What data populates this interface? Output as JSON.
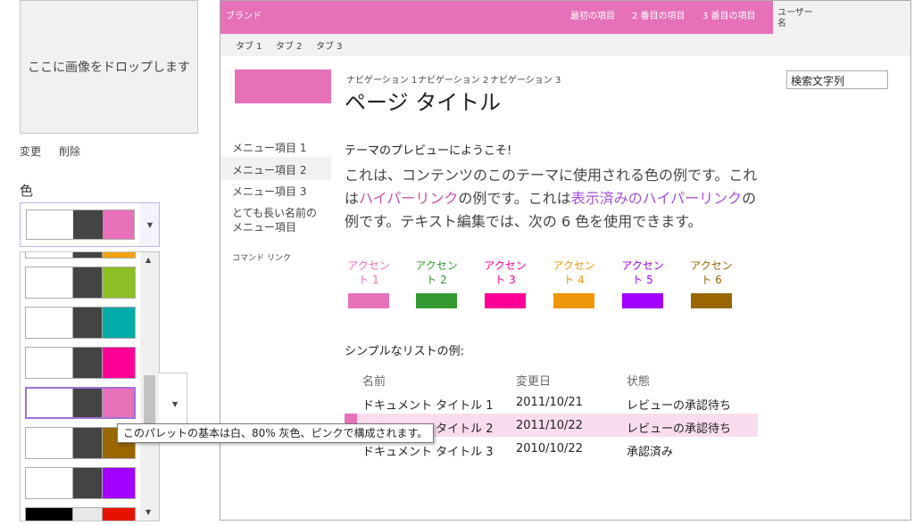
{
  "left_panel": {
    "dropzone_text": "ここに画像をドロップします",
    "change_label": "変更",
    "delete_label": "削除",
    "color_heading": "色",
    "tooltip": "このパレットの基本は白、80% 灰色、ピンクで構成されます。",
    "selected_palette": [
      "#ffffff",
      "#444444",
      "#e671b8"
    ],
    "palettes": [
      [
        "#ffffff",
        "#444444",
        "#f3a20e"
      ],
      [
        "#ffffff",
        "#444444",
        "#8cbf26"
      ],
      [
        "#ffffff",
        "#444444",
        "#00aba9"
      ],
      [
        "#ffffff",
        "#444444",
        "#ff0097"
      ],
      [
        "#ffffff",
        "#444444",
        "#e671b8"
      ],
      [
        "#ffffff",
        "#444444",
        "#996600"
      ],
      [
        "#ffffff",
        "#444444",
        "#a200ff"
      ],
      [
        "#000000",
        "#e8e8e8",
        "#e51400"
      ]
    ],
    "highlighted_palette_index": 4
  },
  "preview": {
    "brand": "ブランド",
    "top_nav": [
      "最初の項目",
      "2 番目の項目",
      "3 番目の項目"
    ],
    "user_name": "ユーザー\n名",
    "tabs": [
      "タブ 1",
      "タブ 2",
      "タブ 3"
    ],
    "breadcrumb": [
      "ナビゲーション 1",
      "ナビゲーション 2",
      "ナビゲーション 3"
    ],
    "page_title": "ページ タイトル",
    "search_value": "検索文字列",
    "menu": [
      "メニュー項目 1",
      "メニュー項目 2",
      "メニュー項目 3",
      "とても長い名前の\nメニュー項目"
    ],
    "command_link": "コマンド リンク",
    "welcome": "テーマのプレビューにようこそ!",
    "body": {
      "part1": "これは、コンテンツのこのテーマに使用される色の例です。これは",
      "link": "ハイパーリンク",
      "part2": "の例です。これは",
      "visited_link": "表示済みのハイパーリンク",
      "part3": "の例です。テキスト編集では、次の 6 色を使用できます。"
    },
    "accents": [
      {
        "label": "アクセン\nト 1",
        "color": "#e671b8"
      },
      {
        "label": "アクセン\nト 2",
        "color": "#339933"
      },
      {
        "label": "アクセン\nト 3",
        "color": "#ff0097"
      },
      {
        "label": "アクセン\nト 4",
        "color": "#f09609"
      },
      {
        "label": "アクセン\nト 5",
        "color": "#a200ff"
      },
      {
        "label": "アクセン\nト 6",
        "color": "#996600"
      }
    ],
    "list_heading": "シンプルなリストの例:",
    "list_headers": [
      "名前",
      "変更日",
      "状態"
    ],
    "list_rows": [
      [
        "ドキュメント タイトル 1",
        "2011/10/21",
        "レビューの承認待ち"
      ],
      [
        "ドキュメント タイトル 2",
        "2011/10/22",
        "レビューの承認待ち"
      ],
      [
        "ドキュメント タイトル 3",
        "2010/10/22",
        "承認済み"
      ]
    ]
  }
}
